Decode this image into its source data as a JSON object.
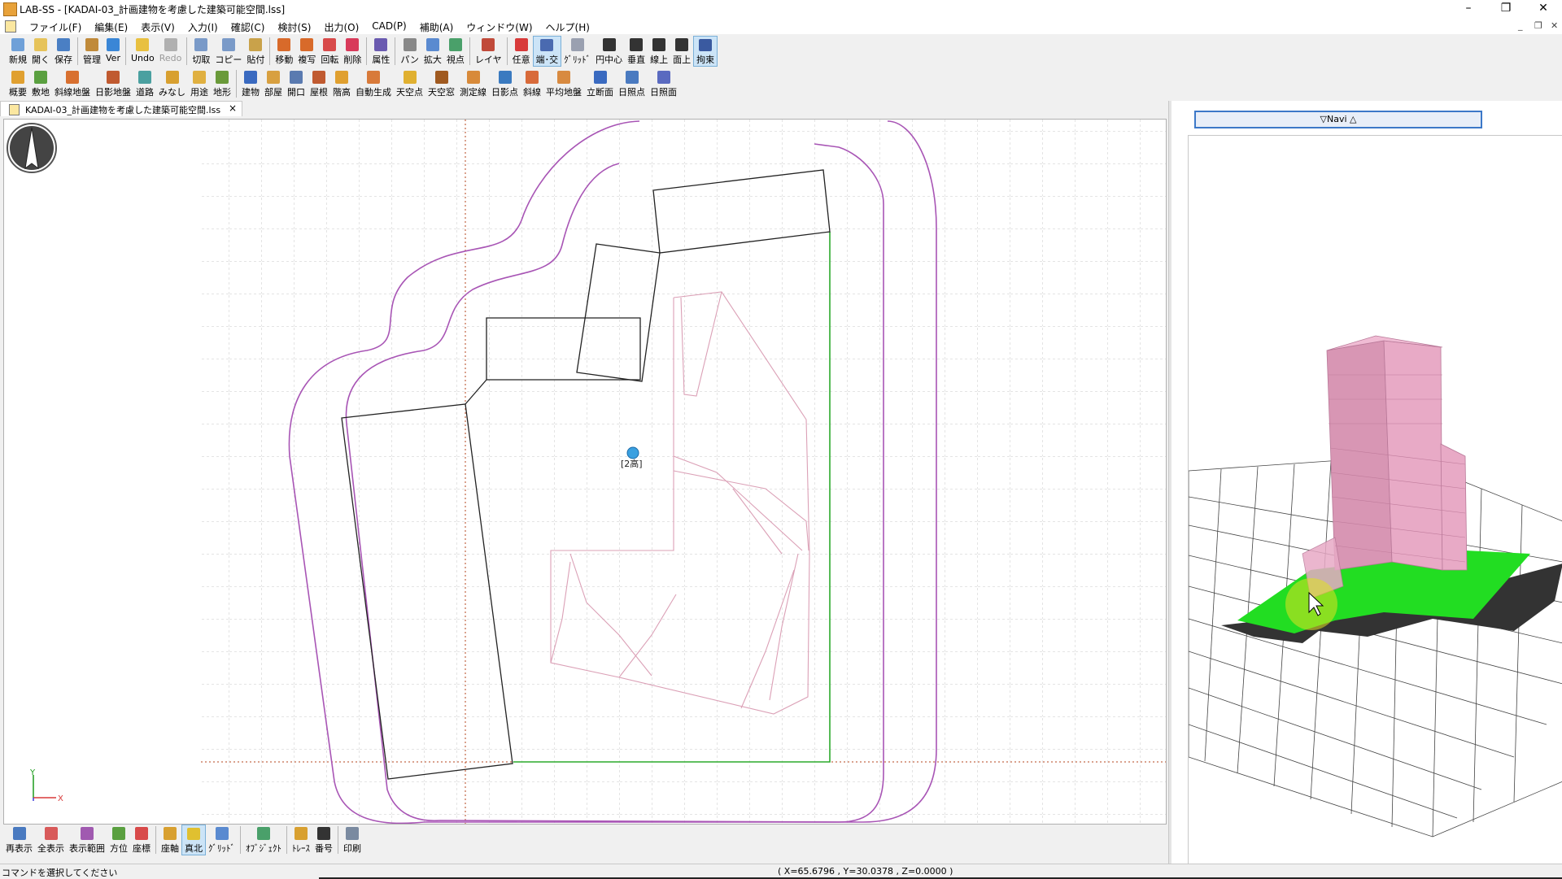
{
  "window": {
    "title": "LAB-SS - [KADAI-03_計画建物を考慮した建築可能空間.lss]"
  },
  "menu": [
    "ファイル(F)",
    "編集(E)",
    "表示(V)",
    "入力(I)",
    "確認(C)",
    "検討(S)",
    "出力(O)",
    "CAD(P)",
    "補助(A)",
    "ウィンドウ(W)",
    "ヘルプ(H)"
  ],
  "toolbar1": [
    {
      "label": "新規",
      "color": "#6fa0d8"
    },
    {
      "label": "開く",
      "color": "#e6c35a"
    },
    {
      "label": "保存",
      "color": "#4a7fc4"
    },
    {
      "label": "管理",
      "color": "#c08a3a"
    },
    {
      "label": "Ver",
      "color": "#3a86d6"
    },
    {
      "label": "Undo",
      "color": "#e8c040"
    },
    {
      "label": "Redo",
      "color": "#b0b0b0",
      "disabled": true
    },
    {
      "label": "切取",
      "color": "#7a9ac8"
    },
    {
      "label": "コピー",
      "color": "#7a9ac8"
    },
    {
      "label": "貼付",
      "color": "#c9a24a"
    },
    {
      "label": "移動",
      "color": "#d86a2a"
    },
    {
      "label": "複写",
      "color": "#d86a2a"
    },
    {
      "label": "回転",
      "color": "#d84a4a"
    },
    {
      "label": "削除",
      "color": "#d83a5a"
    },
    {
      "label": "属性",
      "color": "#6a5ab0"
    },
    {
      "label": "パン",
      "color": "#888888"
    },
    {
      "label": "拡大",
      "color": "#5a8ad0"
    },
    {
      "label": "視点",
      "color": "#4aa06a"
    },
    {
      "label": "レイヤ",
      "color": "#c04a3a"
    },
    {
      "label": "任意",
      "color": "#d83a3a"
    },
    {
      "label": "端･交",
      "color": "#4a6ab0",
      "active": true
    },
    {
      "label": "ｸﾞﾘｯﾄﾞ",
      "color": "#9aa0b0"
    },
    {
      "label": "円中心",
      "color": "#333333"
    },
    {
      "label": "垂直",
      "color": "#333333"
    },
    {
      "label": "線上",
      "color": "#333333"
    },
    {
      "label": "面上",
      "color": "#333333"
    },
    {
      "label": "拘束",
      "color": "#3a5aa0",
      "active": true
    }
  ],
  "toolbar2": [
    {
      "label": "概要",
      "color": "#e0a030"
    },
    {
      "label": "敷地",
      "color": "#5aa040"
    },
    {
      "label": "斜線地盤",
      "color": "#d87030"
    },
    {
      "label": "日影地盤",
      "color": "#c05a30"
    },
    {
      "label": "道路",
      "color": "#4aa0a0"
    },
    {
      "label": "みなし",
      "color": "#d8a030"
    },
    {
      "label": "用途",
      "color": "#e0b040"
    },
    {
      "label": "地形",
      "color": "#6a9a3a"
    },
    {
      "label": "建物",
      "color": "#3a6ac0"
    },
    {
      "label": "部屋",
      "color": "#d8a040"
    },
    {
      "label": "開口",
      "color": "#5a7ab0"
    },
    {
      "label": "屋根",
      "color": "#c05a30"
    },
    {
      "label": "階高",
      "color": "#e0a030"
    },
    {
      "label": "自動生成",
      "color": "#d87a3a"
    },
    {
      "label": "天空点",
      "color": "#e0b030"
    },
    {
      "label": "天空窓",
      "color": "#a05a20"
    },
    {
      "label": "測定線",
      "color": "#d88a3a"
    },
    {
      "label": "日影点",
      "color": "#3a7ac0"
    },
    {
      "label": "斜線",
      "color": "#d86a3a"
    },
    {
      "label": "平均地盤",
      "color": "#d88a40"
    },
    {
      "label": "立断面",
      "color": "#3a6ac0"
    },
    {
      "label": "日照点",
      "color": "#4a7ac0"
    },
    {
      "label": "日照面",
      "color": "#5a6ac0"
    }
  ],
  "doc_tab": {
    "label": "KADAI-03_計画建物を考慮した建築可能空間.lss",
    "close": "×"
  },
  "drawing": {
    "marker_label": "[2高]"
  },
  "axis": {
    "y": "Y",
    "x": "X"
  },
  "bottom_toolbar": [
    {
      "label": "再表示",
      "color": "#4a7ac0"
    },
    {
      "label": "全表示",
      "color": "#d85a5a"
    },
    {
      "label": "表示範囲",
      "color": "#a05ab0"
    },
    {
      "label": "方位",
      "color": "#5aa040"
    },
    {
      "label": "座標",
      "color": "#d84a4a"
    },
    {
      "label": "座軸",
      "color": "#d8a030"
    },
    {
      "label": "真北",
      "color": "#e0c030",
      "active": true
    },
    {
      "label": "ｸﾞﾘｯﾄﾞ",
      "color": "#5a8ad0"
    },
    {
      "label": "ｵﾌﾞｼﾞｪｸﾄ",
      "color": "#4aa06a"
    },
    {
      "label": "ﾄﾚｰｽ",
      "color": "#d8a030"
    },
    {
      "label": "番号",
      "color": "#333333"
    },
    {
      "label": "印刷",
      "color": "#7a8aa0"
    }
  ],
  "navi": {
    "label": "▽Navi △"
  },
  "status": {
    "message": "コマンドを選択してください",
    "coords": "( X=65.6796 , Y=30.0378 , Z=0.0000 )"
  },
  "colors": {
    "accent": "#3c78c8",
    "outline": "#a855b5",
    "building": "#e8a0c0",
    "site": "#22dd22"
  }
}
